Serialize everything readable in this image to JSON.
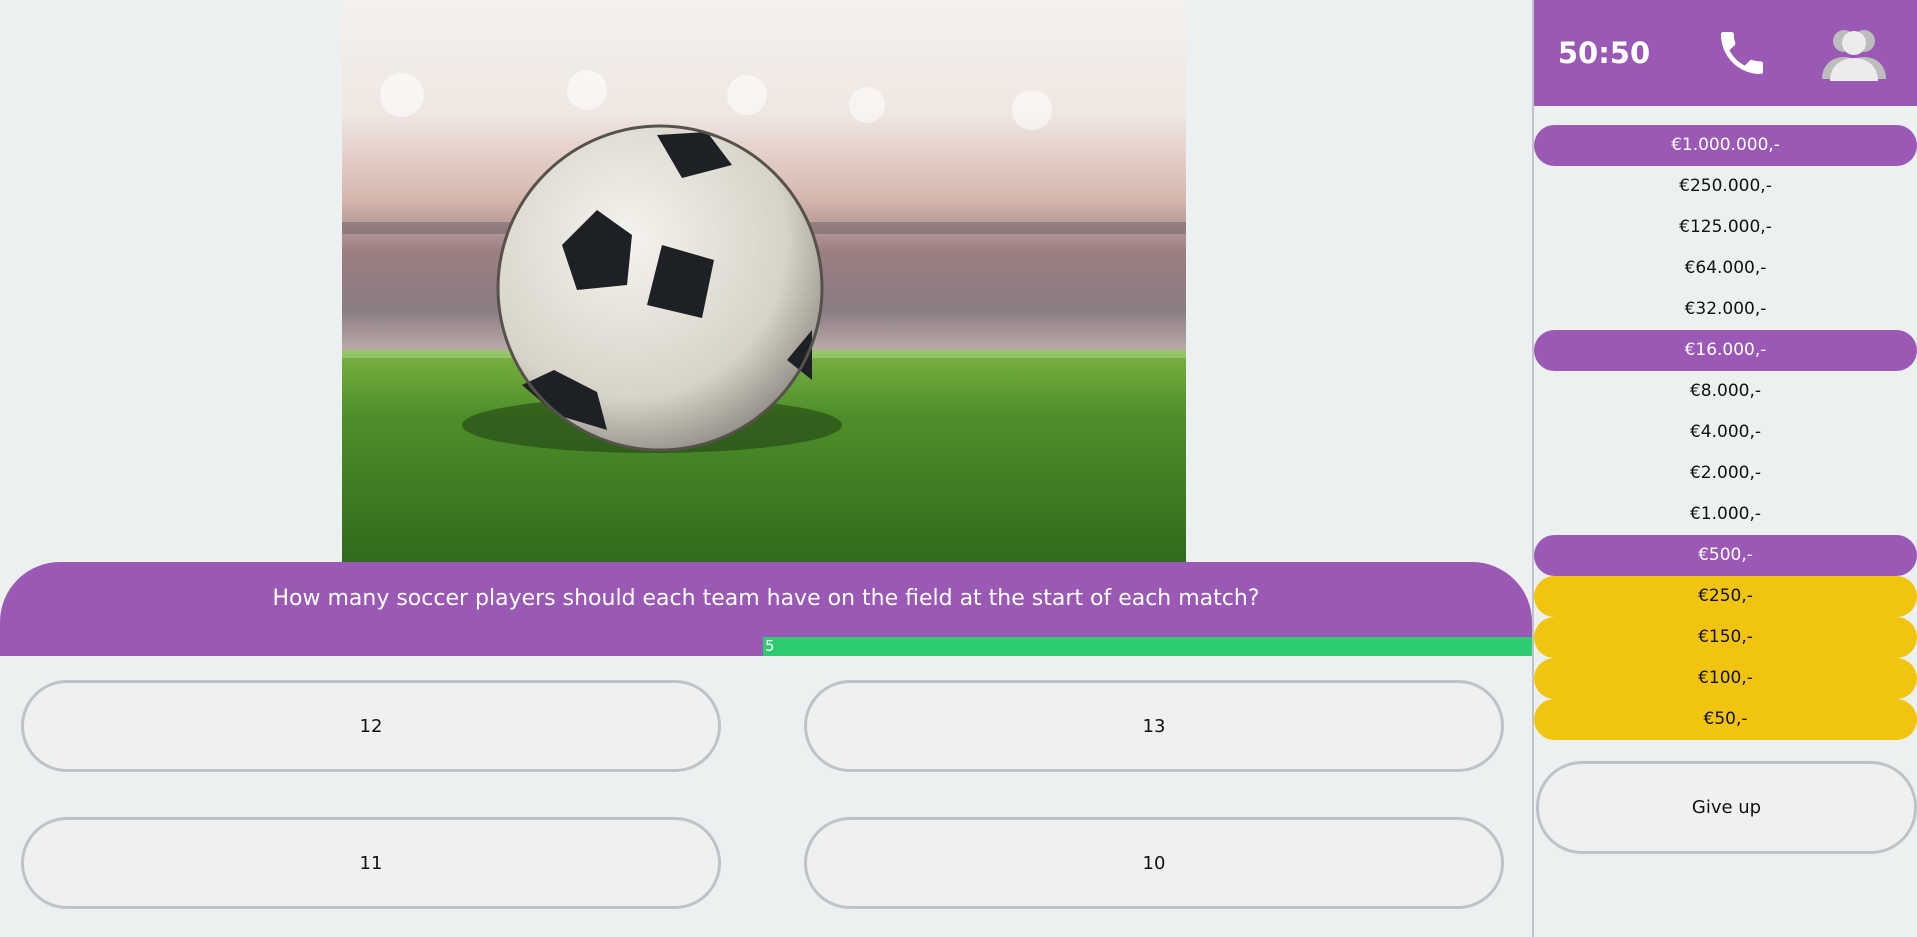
{
  "question": {
    "text": "How many soccer players should each team have on the field at the start of each match?",
    "image": "soccer-ball-on-stadium-grass"
  },
  "timer": {
    "label": "5",
    "remaining_fraction": 0.5
  },
  "answers": [
    {
      "label": "12"
    },
    {
      "label": "13"
    },
    {
      "label": "11"
    },
    {
      "label": "10"
    }
  ],
  "lifelines": {
    "fifty_fifty": "50:50",
    "phone_icon": "phone-icon",
    "audience_icon": "audience-icon"
  },
  "ladder": [
    {
      "amount": "€1.000.000,-",
      "type": "milestone"
    },
    {
      "amount": "€250.000,-",
      "type": "normal"
    },
    {
      "amount": "€125.000,-",
      "type": "normal"
    },
    {
      "amount": "€64.000,-",
      "type": "normal"
    },
    {
      "amount": "€32.000,-",
      "type": "normal"
    },
    {
      "amount": "€16.000,-",
      "type": "milestone"
    },
    {
      "amount": "€8.000,-",
      "type": "normal"
    },
    {
      "amount": "€4.000,-",
      "type": "normal"
    },
    {
      "amount": "€2.000,-",
      "type": "normal"
    },
    {
      "amount": "€1.000,-",
      "type": "normal"
    },
    {
      "amount": "€500,-",
      "type": "milestone"
    },
    {
      "amount": "€250,-",
      "type": "guaranteed"
    },
    {
      "amount": "€150,-",
      "type": "guaranteed"
    },
    {
      "amount": "€100,-",
      "type": "guaranteed"
    },
    {
      "amount": "€50,-",
      "type": "guaranteed"
    }
  ],
  "give_up_label": "Give up",
  "colors": {
    "purple": "#9b59b6",
    "green": "#2ecc71",
    "yellow": "#f1c40f",
    "background": "#ecf0f1",
    "border": "#bdc3c7"
  }
}
